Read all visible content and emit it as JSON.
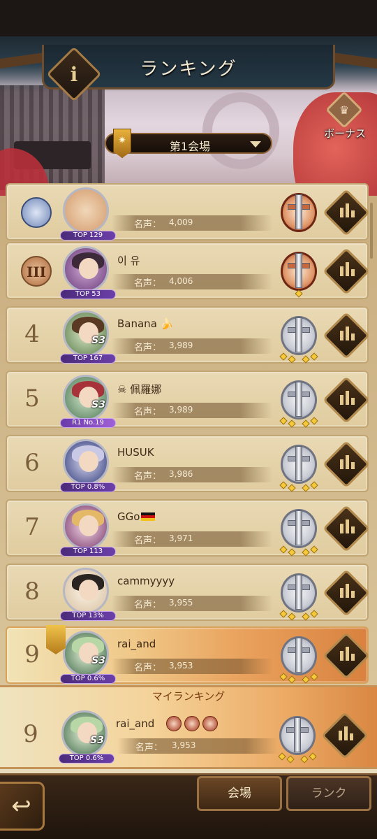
{
  "header": {
    "title": "ランキング",
    "info_label": "i",
    "bonus_label": "ボーナス",
    "bonus_icon": "♛",
    "venue": "第1会場",
    "venue_badge_icon": "✷"
  },
  "rows": [
    {
      "rank": "",
      "medal": "",
      "name": "",
      "fame_label": "名声：",
      "fame": "4,009",
      "tag": "TOP 129",
      "trophy": "bronze"
    },
    {
      "rank": "",
      "medal": "III",
      "name": "이 유",
      "fame_label": "名声：",
      "fame": "4,006",
      "tag": "TOP 53",
      "trophy": "bronze"
    },
    {
      "rank": "4",
      "medal": "",
      "name": "Banana 🍌",
      "fame_label": "名声：",
      "fame": "3,989",
      "tag": "TOP 167",
      "trophy": "silver"
    },
    {
      "rank": "5",
      "medal": "",
      "name": "☠ 佩羅娜",
      "fame_label": "名声：",
      "fame": "3,989",
      "tag": "R1 No.19",
      "trophy": "silver"
    },
    {
      "rank": "6",
      "medal": "",
      "name": "HUSUK",
      "fame_label": "名声：",
      "fame": "3,986",
      "tag": "TOP 0.8%",
      "trophy": "silver"
    },
    {
      "rank": "7",
      "medal": "",
      "name": "GGo",
      "fame_label": "名声：",
      "fame": "3,971",
      "tag": "TOP 113",
      "trophy": "silver"
    },
    {
      "rank": "8",
      "medal": "",
      "name": "cammyyyy",
      "fame_label": "名声：",
      "fame": "3,955",
      "tag": "TOP 13%",
      "trophy": "silver"
    },
    {
      "rank": "9",
      "medal": "",
      "name": "rai_and",
      "fame_label": "名声：",
      "fame": "3,953",
      "tag": "TOP 0.6%",
      "trophy": "silver"
    }
  ],
  "my_ranking": {
    "title": "マイランキング",
    "rank": "9",
    "name": "rai_and",
    "fame_label": "名声：",
    "fame": "3,953",
    "tag": "TOP 0.6%"
  },
  "bottom": {
    "back_icon": "↩",
    "tab_venue": "会場",
    "tab_rank": "ランク"
  },
  "colors": {
    "accent": "#b38a4e",
    "mine_row": "#e9a25d",
    "text_dark": "#3e2a17"
  }
}
